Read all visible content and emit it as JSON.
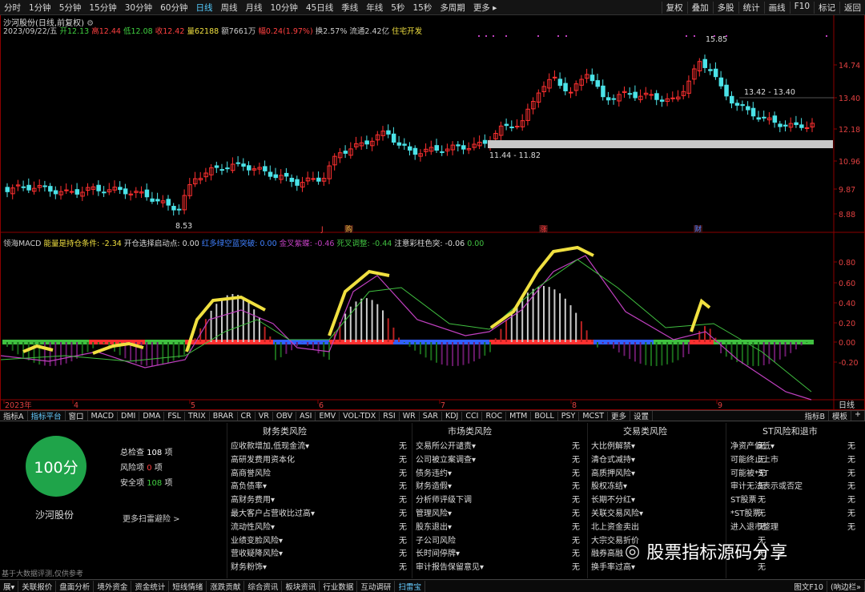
{
  "topbar": {
    "periods": [
      "分时",
      "1分钟",
      "5分钟",
      "15分钟",
      "30分钟",
      "60分钟",
      "日线",
      "周线",
      "月线",
      "10分钟",
      "45日线",
      "季线",
      "年线",
      "5秒",
      "15秒",
      "多周期",
      "更多 ▸"
    ],
    "right": [
      "复权",
      "叠加",
      "多股",
      "统计",
      "画线",
      "F10",
      "标记",
      "返回"
    ]
  },
  "info": {
    "title": "沙河股份(日线,前复权)",
    "date": "2023/09/22/五",
    "open": "开12.13",
    "high": "高12.44",
    "low": "低12.08",
    "close": "收12.42",
    "vol": "量62188",
    "amt": "额7661万",
    "chg": "幅0.24(1.97%)",
    "turn": "换2.57%",
    "float": "流通2.42亿",
    "tag": "住宅开发"
  },
  "macd": {
    "name": "领海MACD",
    "a": "能量是持仓条件: -2.34",
    "b": "开仓选择启动点: 0.00",
    "c": "红多绿空蓝突破: 0.00",
    "d": "金叉紫蝶: -0.46",
    "e": "死叉调整: -0.44",
    "f": "注意彩柱色突: -0.06",
    "g": "0.00"
  },
  "price_axis": [
    "14.74",
    "13.40",
    "12.18",
    "10.96",
    "9.87",
    "8.88"
  ],
  "macd_axis": [
    "0.80",
    "0.60",
    "0.40",
    "0.20",
    "0.00",
    "-0.20"
  ],
  "annotations": {
    "high": "15.85",
    "low": "8.53",
    "r1": "13.42 - 13.40",
    "r2": "11.44 - 11.82"
  },
  "events": [
    "J",
    "购",
    "涨",
    "财"
  ],
  "months": [
    "2023年",
    "4",
    "5",
    "6",
    "7",
    "8",
    "9"
  ],
  "xaxis_right": "日线",
  "tabs": [
    "指标A",
    "指标平台",
    "窗口",
    "MACD",
    "DMI",
    "DMA",
    "FSL",
    "TRIX",
    "BRAR",
    "CR",
    "VR",
    "OBV",
    "ASI",
    "EMV",
    "VOL-TDX",
    "RSI",
    "WR",
    "SAR",
    "KDJ",
    "CCI",
    "ROC",
    "MTM",
    "BOLL",
    "PSY",
    "MCST",
    "更多",
    "设置"
  ],
  "tabs_right": [
    "指标B",
    "模板",
    "+"
  ],
  "score": {
    "value": "100分",
    "name": "沙河股份",
    "total_l": "总检查",
    "total": "108",
    "risk_l": "风险项",
    "risk": "0",
    "safe_l": "安全项",
    "safe": "108",
    "unit": "项",
    "more": "更多扫雷避险 >",
    "note": "基于大数据评测,仅供参考"
  },
  "cols": [
    {
      "title": "财务类风险",
      "items": [
        "应收款增加,低现金流▾",
        "高研发费用资本化",
        "高商誉风险",
        "高负债率▾",
        "高财务费用▾",
        "最大客户占营收比过高▾",
        "流动性风险▾",
        "业绩变脸风险▾",
        "营收疑降风险▾",
        "财务粉饰▾"
      ]
    },
    {
      "title": "市场类风险",
      "items": [
        "交易所公开谴责▾",
        "公司被立案调查▾",
        "债务违约▾",
        "财务造假▾",
        "分析师评级下调",
        "管理风险▾",
        "股东退出▾",
        "子公司风险",
        "长时间停牌▾",
        "审计报告保留意见▾"
      ]
    },
    {
      "title": "交易类风险",
      "items": [
        "大比例解禁▾",
        "清仓式减持▾",
        "高质押风险▾",
        "股权冻结▾",
        "长期不分红▾",
        "关联交易风险▾",
        "北上资金卖出",
        "大宗交易折价",
        "融券高融",
        "换手率过高▾"
      ]
    },
    {
      "title": "ST风险和退市",
      "items": [
        "净资产偏低▾",
        "可能终止上市",
        "可能被*ST",
        "审计无法表示或否定",
        "ST股票",
        "*ST股票",
        "进入退市整理"
      ]
    }
  ],
  "none": "无",
  "bottom": [
    "展▾",
    "关联报价",
    "盘面分析",
    "境外资金",
    "资金统计",
    "短线情绪",
    "涨跌贡献",
    "综合资讯",
    "板块资讯",
    "行业数据",
    "互动调研",
    "扫雷宝"
  ],
  "bottom_right": [
    "图文F10",
    "(吶边栏»"
  ],
  "watermark": "股票指标源码分享",
  "colors": {
    "up": "#ff3030",
    "down": "#4be3e8",
    "dif": "#c040c0",
    "dea": "#40c040",
    "hl": "#f0e040"
  }
}
